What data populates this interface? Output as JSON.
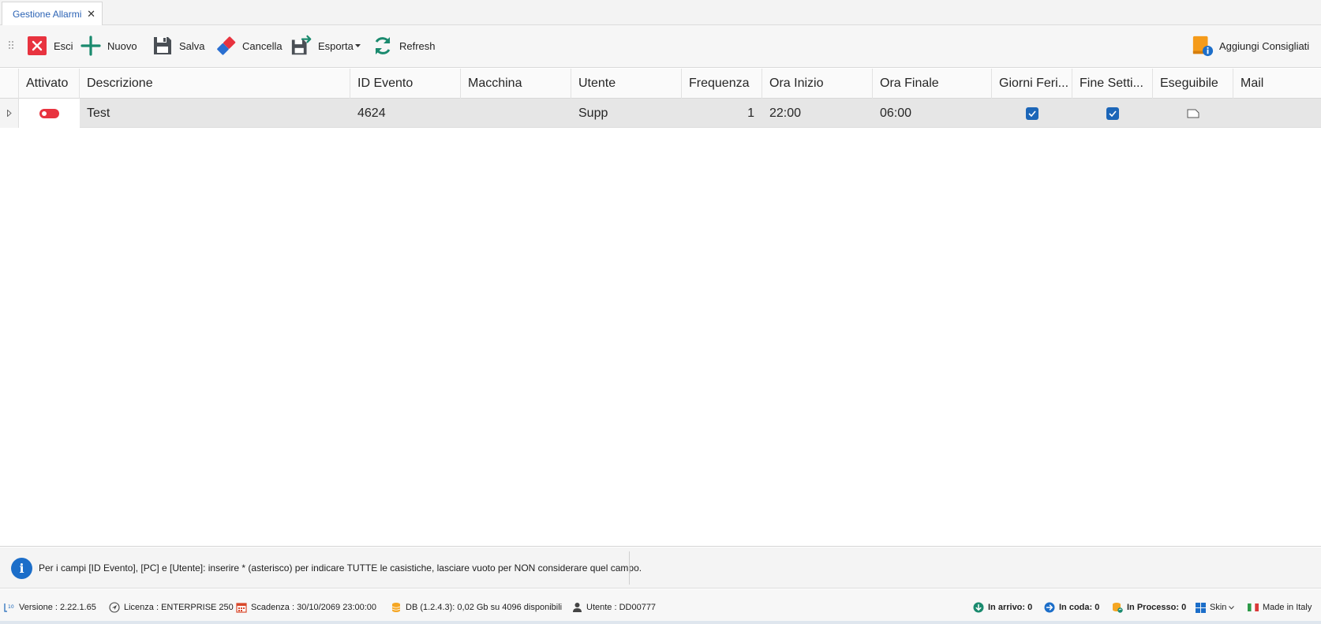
{
  "tab": {
    "label": "Gestione Allarmi",
    "close": "✕"
  },
  "toolbar": {
    "esci": "Esci",
    "nuovo": "Nuovo",
    "salva": "Salva",
    "cancella": "Cancella",
    "esporta": "Esporta",
    "refresh": "Refresh",
    "aggiungi": "Aggiungi Consigliati"
  },
  "grid": {
    "columns": [
      "Attivato",
      "Descrizione",
      "ID Evento",
      "Macchina",
      "Utente",
      "Frequenza",
      "Ora Inizio",
      "Ora Finale",
      "Giorni Feri...",
      "Fine Setti...",
      "Eseguibile",
      "Mail"
    ],
    "rows": [
      {
        "attivato": false,
        "descrizione": "Test",
        "id_evento": "4624",
        "macchina": "",
        "utente": "Supp",
        "frequenza": "1",
        "ora_inizio": "22:00",
        "ora_finale": "06:00",
        "giorni_feriali": true,
        "fine_settimana": true,
        "eseguibile": "",
        "mail": ""
      }
    ]
  },
  "info": {
    "icon": "info-icon",
    "text": "Per i campi [ID Evento], [PC] e [Utente]: inserire * (asterisco) per indicare TUTTE le casistiche, lasciare vuoto per NON considerare quel campo."
  },
  "status": {
    "versione": "Versione : 2.22.1.65",
    "licenza": "Licenza : ENTERPRISE 250",
    "scadenza": "Scadenza : 30/10/2069 23:00:00",
    "db": "DB (1.2.4.3): 0,02 Gb su 4096 disponibili",
    "utente": "Utente : DD00777",
    "in_arrivo": "In arrivo: 0",
    "in_coda": "In coda: 0",
    "in_processo": "In Processo: 0",
    "skin": "Skin",
    "made_in": "Made in Italy"
  },
  "colors": {
    "accent": "#1c66b8",
    "danger": "#e8333f",
    "teal": "#1a8a6e",
    "orange": "#f59b1a"
  }
}
